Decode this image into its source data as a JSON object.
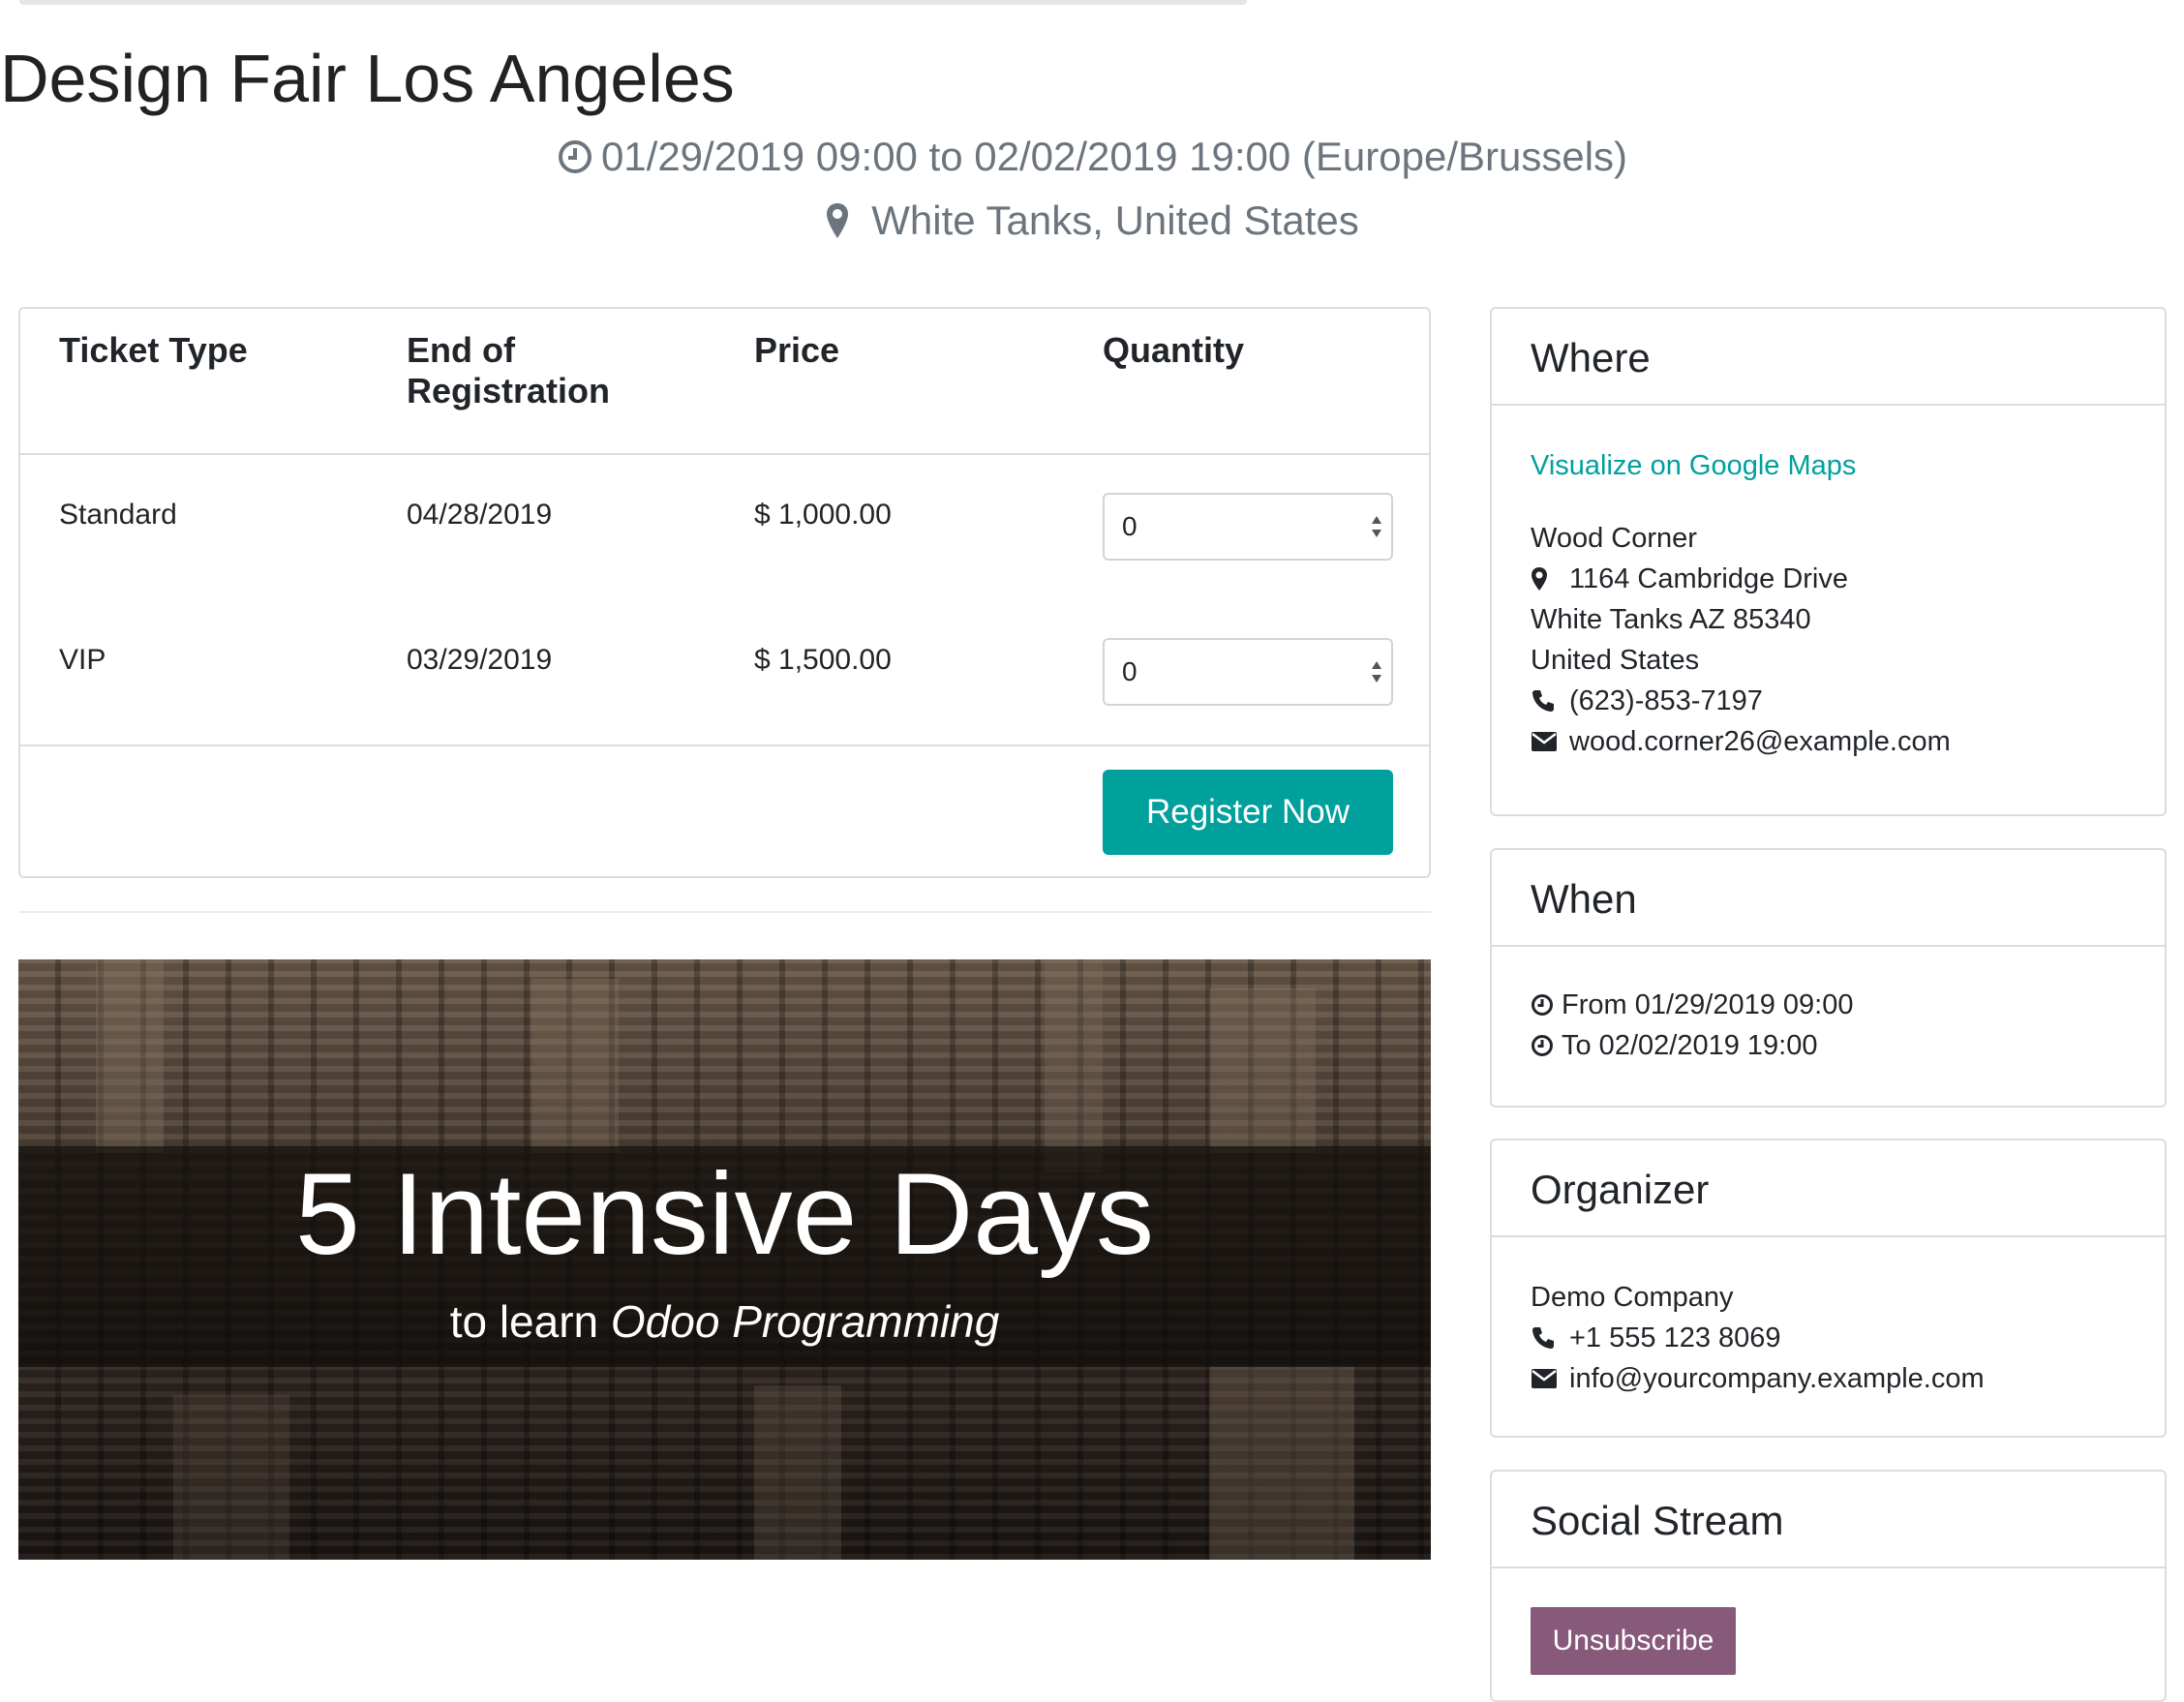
{
  "event": {
    "title": "Design Fair Los Angeles",
    "dates": "01/29/2019 09:00 to 02/02/2019 19:00 (Europe/Brussels)",
    "location": "White Tanks, United States"
  },
  "tickets": {
    "headers": {
      "type": "Ticket Type",
      "end_line1": "End of",
      "end_line2": "Registration",
      "price": "Price",
      "quantity": "Quantity"
    },
    "rows": [
      {
        "type": "Standard",
        "end": "04/28/2019",
        "price": "$ 1,000.00",
        "quantity": "0"
      },
      {
        "type": "VIP",
        "end": "03/29/2019",
        "price": "$ 1,500.00",
        "quantity": "0"
      }
    ],
    "register_label": "Register Now"
  },
  "banner": {
    "title": "5 Intensive Days",
    "sub_prefix": "to learn",
    "sub_emph": "Odoo Programming"
  },
  "where": {
    "title": "Where",
    "maps_link": "Visualize on Google Maps",
    "name": "Wood Corner",
    "street": "1164 Cambridge Drive",
    "city": "White Tanks AZ 85340",
    "country": "United States",
    "phone": "(623)-853-7197",
    "email": "wood.corner26@example.com"
  },
  "when": {
    "title": "When",
    "from": "From 01/29/2019 09:00",
    "to": "To 02/02/2019 19:00"
  },
  "organizer": {
    "title": "Organizer",
    "name": "Demo Company",
    "phone": "+1 555 123 8069",
    "email": "info@yourcompany.example.com"
  },
  "social": {
    "title": "Social Stream",
    "unsubscribe_label": "Unsubscribe"
  },
  "colors": {
    "accent": "#00a09d",
    "brand": "#875a7b",
    "muted": "#6c757d"
  },
  "icons": [
    "clock-icon",
    "map-marker-icon",
    "phone-icon",
    "envelope-icon",
    "spinner-arrows-icon"
  ]
}
